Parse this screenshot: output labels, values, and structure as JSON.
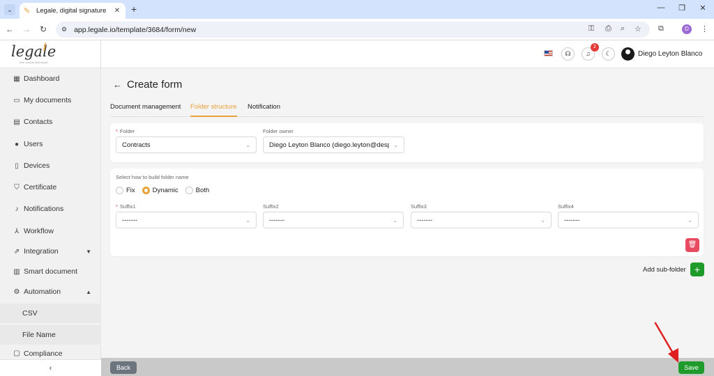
{
  "browser": {
    "tab_title": "Legale, digital signature",
    "url": "app.legale.io/template/3684/form/new",
    "profile_initial": "D"
  },
  "sidebar": {
    "logo": "legale",
    "tagline": "free, secure and smart",
    "items": [
      {
        "label": "Dashboard",
        "icon": "dashboard-icon"
      },
      {
        "label": "My documents",
        "icon": "folder-icon"
      },
      {
        "label": "Contacts",
        "icon": "contacts-icon"
      },
      {
        "label": "Users",
        "icon": "user-icon"
      },
      {
        "label": "Devices",
        "icon": "device-icon"
      },
      {
        "label": "Certificate",
        "icon": "shield-icon"
      },
      {
        "label": "Notifications",
        "icon": "bell-icon"
      },
      {
        "label": "Workflow",
        "icon": "workflow-icon"
      },
      {
        "label": "Integration",
        "icon": "external-link-icon"
      },
      {
        "label": "Smart document",
        "icon": "layout-icon"
      },
      {
        "label": "Automation",
        "icon": "gear-icon"
      },
      {
        "label": "Compliance",
        "icon": "book-icon"
      }
    ],
    "sub_items": [
      "CSV",
      "File Name"
    ]
  },
  "header": {
    "notifications_count": "2",
    "user_name": "Diego Leyton Blanco"
  },
  "main": {
    "title": "Create form",
    "tabs": [
      "Document management",
      "Folder structure",
      "Notification"
    ],
    "active_tab": 1,
    "folder": {
      "label": "Folder",
      "value": "Contracts",
      "owner_label": "Folder owner",
      "owner_value": "Diego Leyton Blanco (diego.leyton@despap..."
    },
    "build": {
      "label": "Select how to build folder name",
      "options": [
        "Fix",
        "Dynamic",
        "Both"
      ],
      "selected": "Dynamic"
    },
    "suffixes": [
      {
        "label": "Suffix1",
        "value": "-------"
      },
      {
        "label": "Suffix2",
        "value": "-------"
      },
      {
        "label": "Suffix3",
        "value": "-------"
      },
      {
        "label": "Suffix4",
        "value": "-------"
      }
    ],
    "add_subfolder_label": "Add sub-folder"
  },
  "footer": {
    "back_label": "Back",
    "save_label": "Save"
  },
  "colors": {
    "accent": "#e9a13b",
    "save_green": "#1e9b2a",
    "danger": "#e84a5f",
    "annotation_arrow": "#e02020"
  }
}
